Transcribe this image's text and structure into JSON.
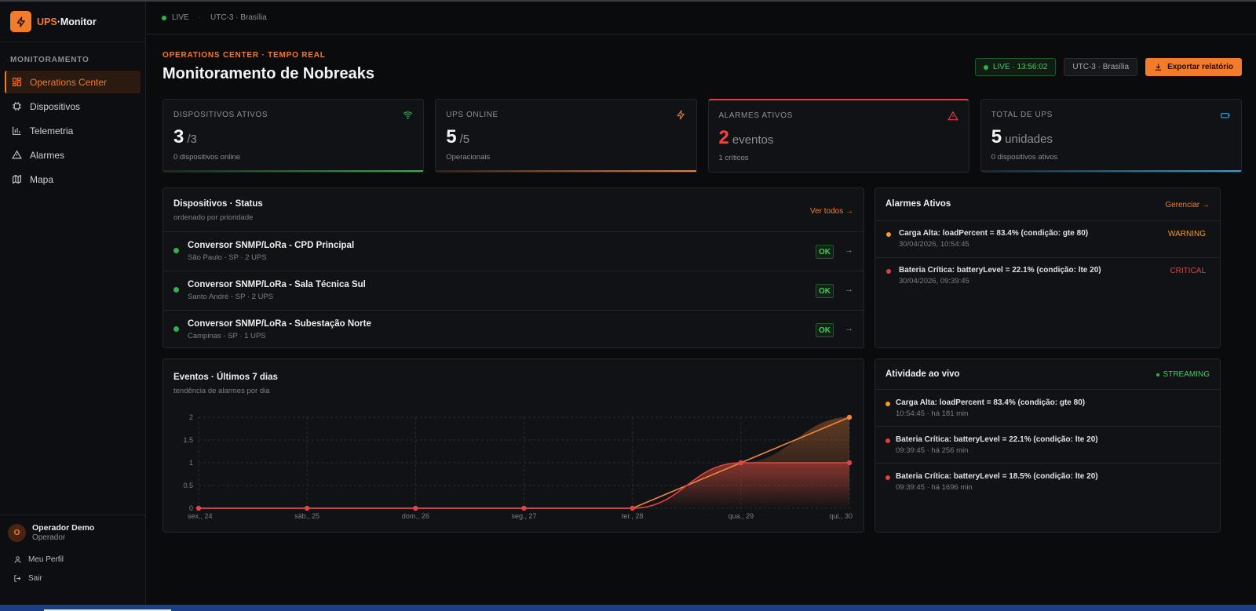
{
  "app": {
    "brand_prefix": "UPS",
    "brand_suffix": "·Monitor",
    "accent": "#f37b2c"
  },
  "sidebar": {
    "section": "MONITORAMENTO",
    "items": [
      {
        "label": "Operations Center",
        "icon": "grid-icon",
        "active": true
      },
      {
        "label": "Dispositivos",
        "icon": "chip-icon",
        "active": false
      },
      {
        "label": "Telemetria",
        "icon": "bar-chart-icon",
        "active": false
      },
      {
        "label": "Alarmes",
        "icon": "warning-icon",
        "active": false
      },
      {
        "label": "Mapa",
        "icon": "map-icon",
        "active": false
      }
    ],
    "user": {
      "initial": "O",
      "name": "Operador Demo",
      "role": "Operador"
    },
    "profile_label": "Meu Perfil",
    "logout_label": "Sair"
  },
  "headerbar": {
    "live": "LIVE",
    "timezone": "UTC-3 · Brasília"
  },
  "page": {
    "eyebrow": "OPERATIONS CENTER · TEMPO REAL",
    "title": "Monitoramento de Nobreaks",
    "live_clock": "LIVE · 13:56:02",
    "timezone": "UTC-3 · Brasília",
    "export_label": "Exportar relatório"
  },
  "kpis": [
    {
      "label": "DISPOSITIVOS ATIVOS",
      "value": "3",
      "unit": "/3",
      "sub": "0 dispositivos online",
      "icon": "wifi-icon",
      "color": "#2fb34a"
    },
    {
      "label": "UPS ONLINE",
      "value": "5",
      "unit": "/5",
      "sub": "Operacionais",
      "icon": "bolt-icon",
      "color": "#f37b2c"
    },
    {
      "label": "ALARMES ATIVOS",
      "value": "2",
      "unit": "eventos",
      "sub": "1 críticos",
      "icon": "alert-triangle-icon",
      "color": "#e04040"
    },
    {
      "label": "TOTAL DE UPS",
      "value": "5",
      "unit": "unidades",
      "sub": "0 dispositivos ativos",
      "icon": "battery-icon",
      "color": "#2ba3d9"
    }
  ],
  "devices": {
    "title": "Dispositivos · Status",
    "subtitle": "ordenado por prioridade",
    "link": "Ver todos →",
    "rows": [
      {
        "name": "Conversor SNMP/LoRa - CPD Principal",
        "location": "São Paulo - SP · 2 UPS",
        "status": "OK"
      },
      {
        "name": "Conversor SNMP/LoRa - Sala Técnica Sul",
        "location": "Santo André - SP · 2 UPS",
        "status": "OK"
      },
      {
        "name": "Conversor SNMP/LoRa - Subestação Norte",
        "location": "Campinas - SP · 1 UPS",
        "status": "OK"
      }
    ]
  },
  "alarms": {
    "title": "Alarmes Ativos",
    "link": "Gerenciar →",
    "rows": [
      {
        "text": "Carga Alta: loadPercent = 83.4% (condição: gte 80)",
        "time": "30/04/2026, 10:54:45",
        "severity": "WARNING",
        "color": "#f39c2c"
      },
      {
        "text": "Bateria Crítica: batteryLevel = 22.1% (condição: lte 20)",
        "time": "30/04/2026, 09:39:45",
        "severity": "CRITICAL",
        "color": "#e04040"
      }
    ]
  },
  "events_chart": {
    "title": "Eventos · Últimos 7 dias",
    "subtitle": "tendência de alarmes por dia"
  },
  "chart_data": {
    "type": "line",
    "title": "Eventos · Últimos 7 dias",
    "categories": [
      "sex., 24",
      "sáb., 25",
      "dom., 26",
      "seg., 27",
      "ter., 28",
      "qua., 29",
      "qui., 30"
    ],
    "series": [
      {
        "color": "#f0873a",
        "values": [
          0,
          0,
          0,
          0,
          0,
          1,
          2
        ]
      },
      {
        "color": "#e04545",
        "values": [
          0,
          0,
          0,
          0,
          0,
          1,
          1
        ]
      }
    ],
    "y_ticks": [
      "0",
      "0.5",
      "1",
      "1.5",
      "2"
    ],
    "ylim": [
      0,
      2
    ],
    "grid": true
  },
  "live_activity": {
    "title": "Atividade ao vivo",
    "streaming": "STREAMING",
    "rows": [
      {
        "text": "Carga Alta: loadPercent = 83.4% (condição: gte 80)",
        "time": "10:54:45 · há 181 min",
        "color": "#f39c2c"
      },
      {
        "text": "Bateria Crítica: batteryLevel = 22.1% (condição: lte 20)",
        "time": "09:39:45 · há 256 min",
        "color": "#e04040"
      },
      {
        "text": "Bateria Crítica: batteryLevel = 18.5% (condição: lte 20)",
        "time": "09:39:45 · há 1696 min",
        "color": "#e04040"
      }
    ]
  }
}
